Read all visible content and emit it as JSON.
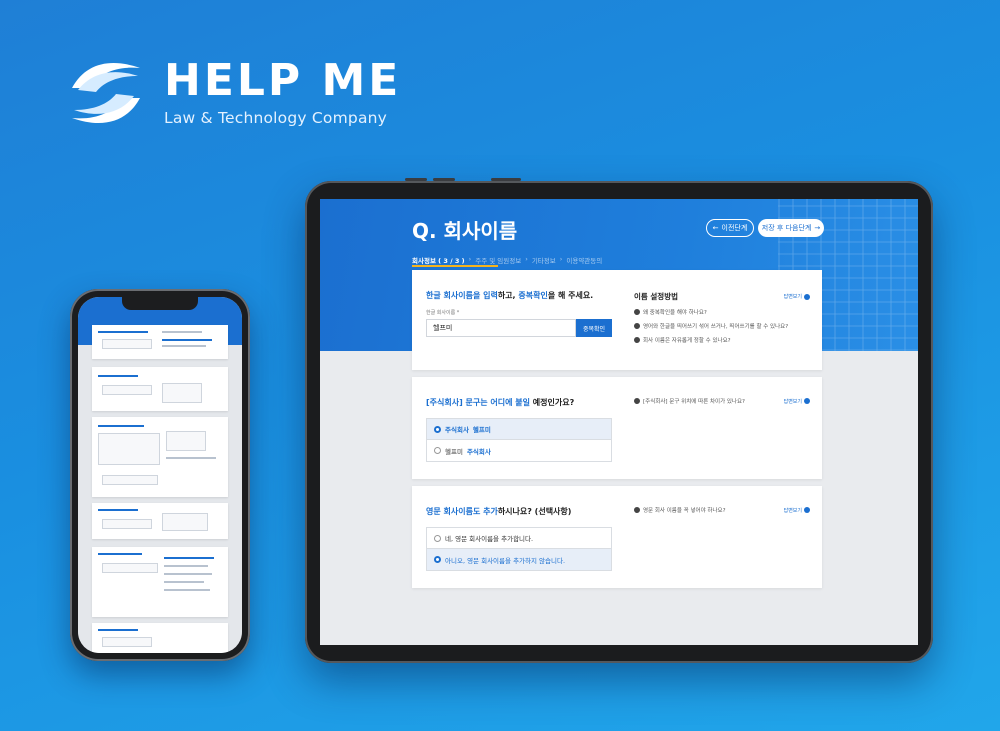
{
  "brand": {
    "name": "HELP ME",
    "tagline": "Law & Technology Company"
  },
  "colors": {
    "primary": "#1b6fd0",
    "background": "#1f8fe0",
    "accent": "#f5b31e"
  },
  "tablet": {
    "question_title": "Q. 회사이름",
    "prev_button": "이전단계",
    "next_button": "저장 후 다음단계",
    "steps": [
      {
        "label": "회사정보 ( 3 / 3 )",
        "current": true
      },
      {
        "label": "주주 및 임원정보",
        "current": false
      },
      {
        "label": "기타정보",
        "current": false
      },
      {
        "label": "이용약관동의",
        "current": false
      }
    ],
    "card1": {
      "question_hl1": "한글 회사이름을 입력",
      "question_mid": "하고, ",
      "question_hl2": "중복확인",
      "question_end": "을 해 주세요.",
      "field_label": "한글 회사이름 *",
      "input_value": "헬프미",
      "check_button": "중복확인",
      "help_title": "이름 설정방법",
      "see_answer": "답변보기",
      "faqs": [
        "왜 중복확인을 해야 하나요?",
        "영어와 한글을 띄어쓰기 섞어 쓰거나, 띄어쓰기를 할 수 있나요?",
        "회사 이름은 자유롭게 정할 수 있나요?"
      ]
    },
    "card2": {
      "question_hl": "[주식회사] 문구는 어디에 붙일",
      "question_end": " 예정인가요?",
      "faq": "[주식회사] 문구 위치에 따른 차이가 있나요?",
      "see_answer": "답변보기",
      "option1_hl": "주식회사",
      "option1_rest": " 헬프미",
      "option2_rest": "헬프미 ",
      "option2_hl": "주식회사"
    },
    "card3": {
      "question_hl": "영문 회사이름도 추가",
      "question_end": "하시나요? (선택사항)",
      "faq": "영문 회사 이름을 꼭 넣어야 하나요?",
      "see_answer": "답변보기",
      "option1": "네, 영문 회사이름을 추가합니다.",
      "option2": "아니오, 영문 회사이름을 추가하지 않습니다."
    }
  }
}
